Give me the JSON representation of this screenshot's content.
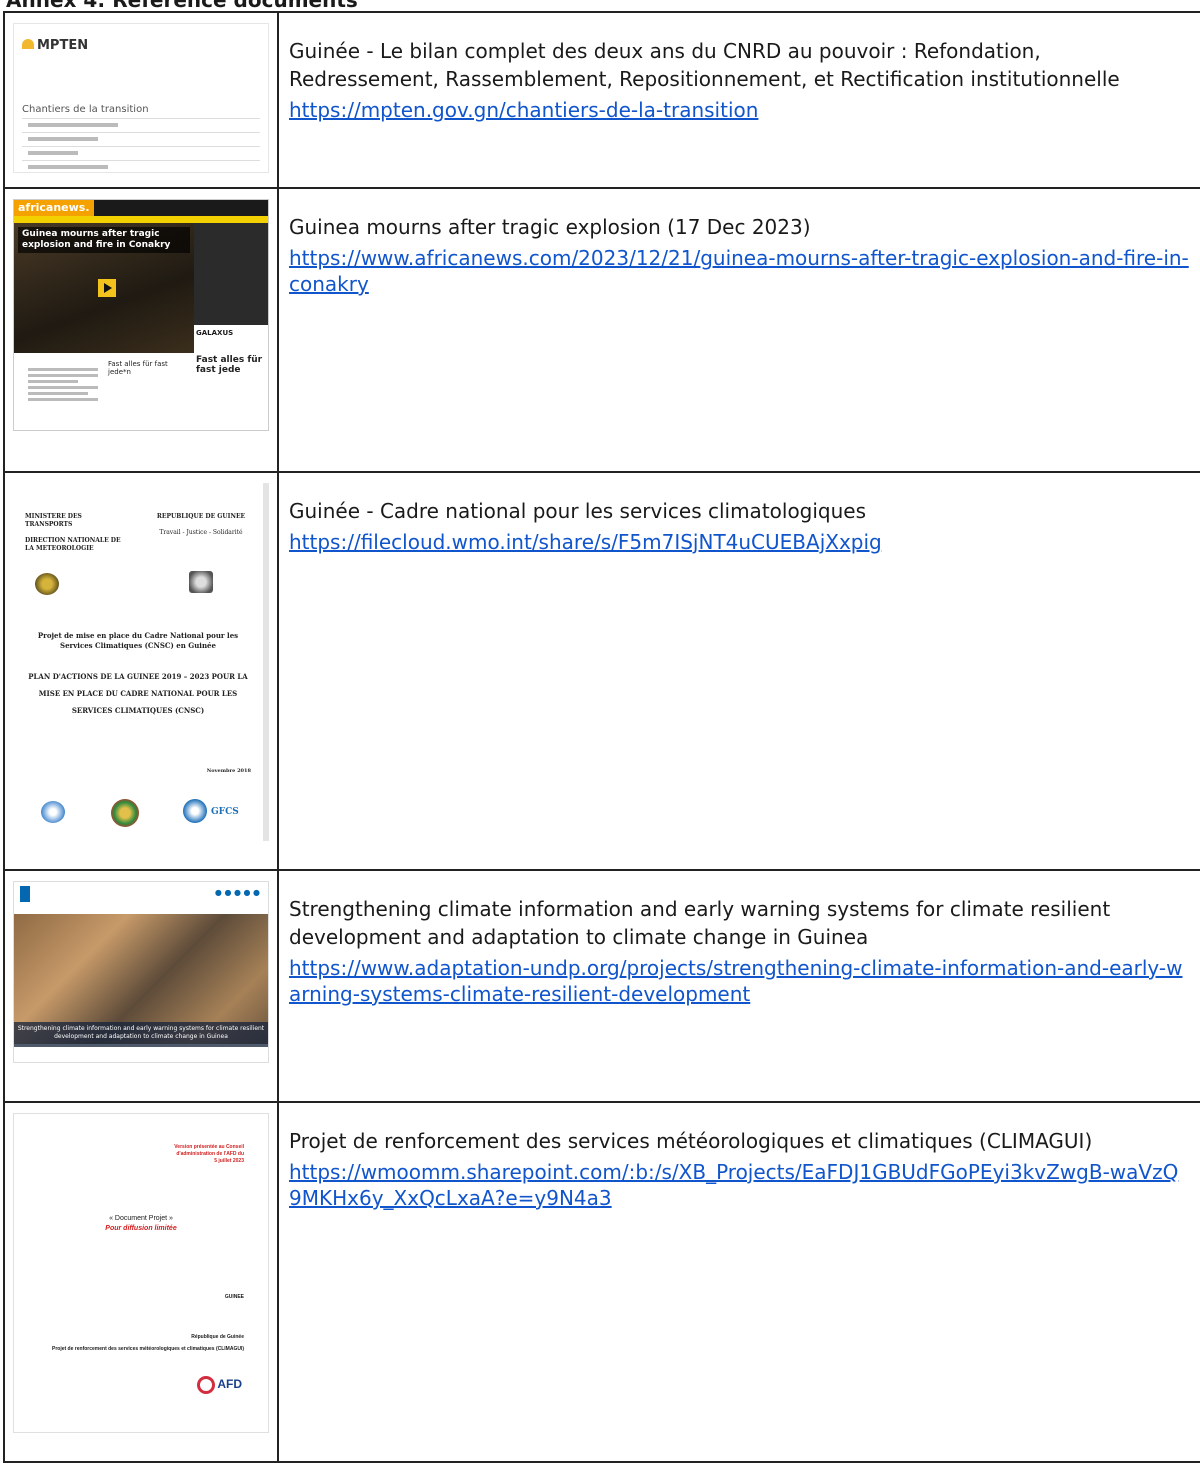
{
  "annex_title": "Annex 4: Reference documents",
  "rows": [
    {
      "title": "Guinée - Le bilan complet des deux ans du CNRD au pouvoir : Refondation, Redressement, Rassemblement, Repositionnement, et Rectification institutionnelle",
      "link": "https://mpten.gov.gn/chantiers-de-la-transition",
      "thumb": {
        "logo": "MPTEN",
        "heading": "Chantiers de la transition"
      }
    },
    {
      "title": "Guinea mourns after tragic explosion (17 Dec 2023)",
      "link": "https://www.africanews.com/2023/12/21/guinea-mourns-after-tragic-explosion-and-fire-in-conakry",
      "thumb": {
        "brand": "africanews.",
        "headline": "Guinea mourns after tragic explosion and fire in Conakry",
        "ad": "Fast alles für fast jede",
        "ad_small": "Fast alles für fast jede*n",
        "ad_brand": "GALAXUS"
      }
    },
    {
      "title": "Guinée - Cadre national pour les services climatologiques",
      "link": "https://filecloud.wmo.int/share/s/F5m7ISjNT4uCUEBAjXxpig",
      "thumb": {
        "left_head": "MINISTERE DES TRANSPORTS",
        "left_sub": "DIRECTION NATIONALE DE LA METEOROLOGIE",
        "right_head": "REPUBLIQUE DE GUINEE",
        "right_sub": "Travail - Justice - Solidarité",
        "project": "Projet de mise en place du Cadre National pour les Services Climatiques (CNSC) en Guinée",
        "plan": "PLAN D'ACTIONS DE LA GUINEE 2019 – 2023 POUR LA MISE EN PLACE DU CADRE NATIONAL POUR LES SERVICES CLIMATIQUES (CNSC)",
        "date": "Novembre 2018",
        "gfcs": "GFCS"
      }
    },
    {
      "title": "Strengthening climate information and early warning systems for climate resilient development and adaptation to climate change in Guinea",
      "link": "https://www.adaptation-undp.org/projects/strengthening-climate-information-and-early-warning-systems-climate-resilient-development",
      "thumb": {
        "caption": "Strengthening climate information and early warning systems for climate resilient development and adaptation to climate change in Guinea"
      }
    },
    {
      "title": "Projet de renforcement des services météorologiques et climatiques (CLIMAGUI)",
      "link": "https://wmoomm.sharepoint.com/:b:/s/XB_Projects/EaFDJ1GBUdFGoPEyi3kvZwgB-waVzQ9MKHx6y_XxQcLxaA?e=y9N4a3",
      "thumb": {
        "red_head": "Version présentée au Conseil d'administration de l'AFD du 5 juillet 2023",
        "doc_label": "« Document Projet »",
        "doc_red": "Pour diffusion limitée",
        "country": "GUINEE",
        "republic": "République de Guinée",
        "project": "Projet de renforcement des services météorologiques et climatiques (CLIMAGUI)",
        "logo": "AFD"
      }
    }
  ]
}
